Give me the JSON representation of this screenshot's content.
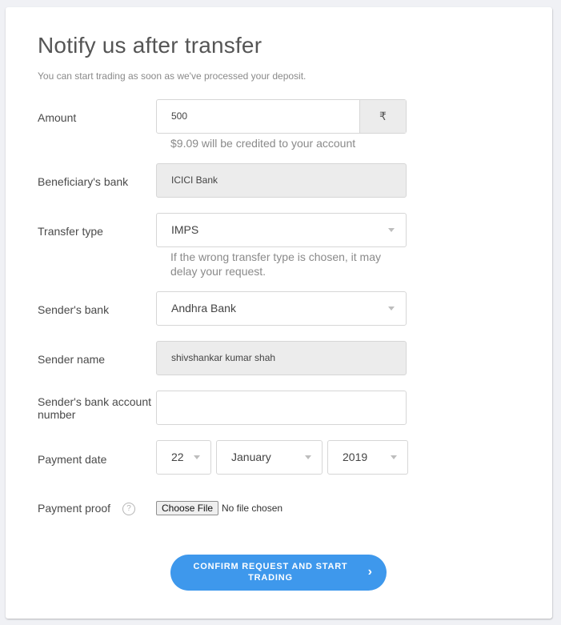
{
  "header": {
    "title": "Notify us after transfer",
    "subtitle": "You can start trading as soon as we've processed your deposit."
  },
  "form": {
    "amount": {
      "label": "Amount",
      "value": "500",
      "currency_symbol": "₹",
      "help": "$9.09 will be credited to your account"
    },
    "beneficiary_bank": {
      "label": "Beneficiary's bank",
      "value": "ICICI Bank"
    },
    "transfer_type": {
      "label": "Transfer type",
      "value": "IMPS",
      "help": "If the wrong transfer type is chosen, it may delay your request."
    },
    "senders_bank": {
      "label": "Sender's bank",
      "value": "Andhra Bank"
    },
    "sender_name": {
      "label": "Sender name",
      "value": "shivshankar kumar shah"
    },
    "account_number": {
      "label": "Sender's bank account number",
      "value": ""
    },
    "payment_date": {
      "label": "Payment date",
      "day": "22",
      "month": "January",
      "year": "2019"
    },
    "payment_proof": {
      "label": "Payment proof",
      "help_icon": "?",
      "button_label": "Choose File",
      "status": "No file chosen"
    }
  },
  "submit": {
    "label": "CONFIRM REQUEST AND START TRADING",
    "chevron": "›"
  }
}
